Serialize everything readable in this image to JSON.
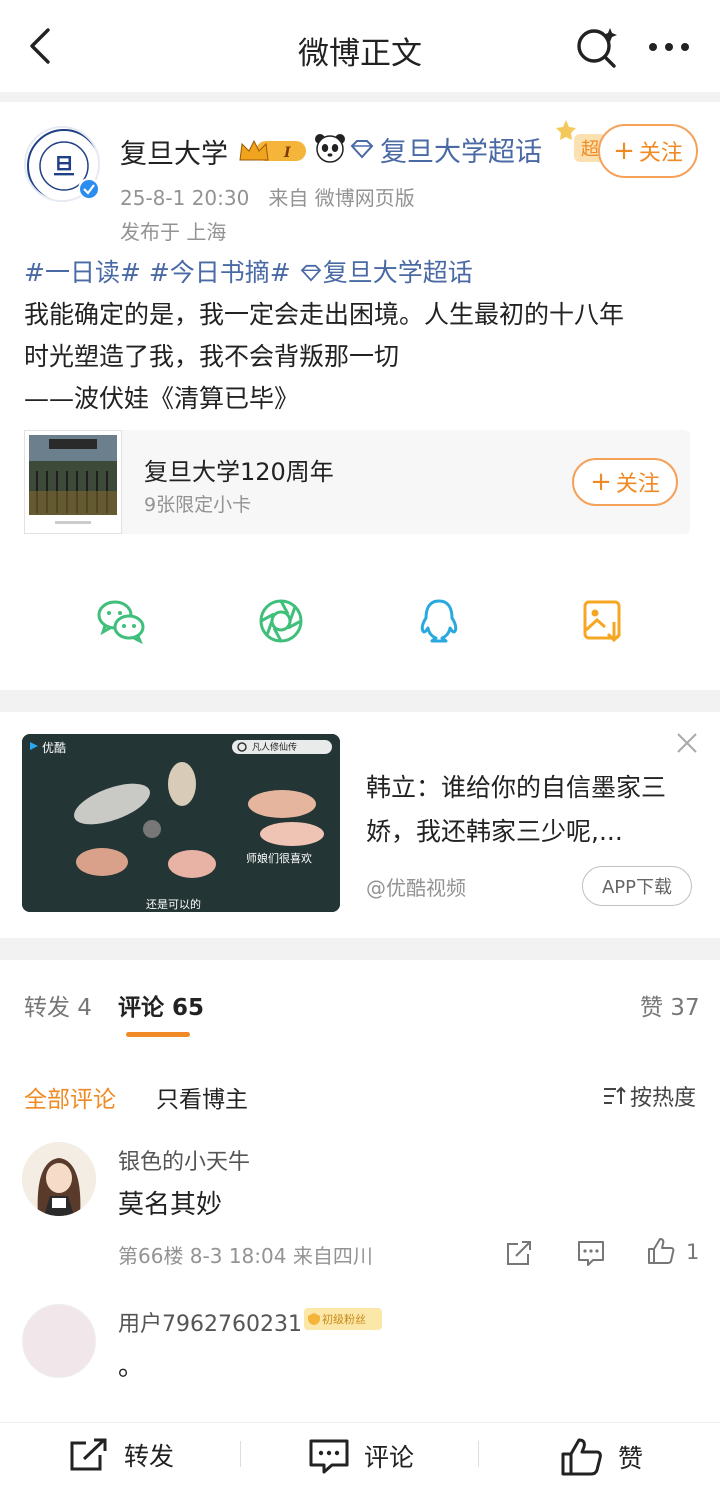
{
  "nav": {
    "title": "微博正文",
    "back_icon": "back-arrow-icon",
    "search_icon": "search-icon",
    "more_icon": "more-dots-icon"
  },
  "post": {
    "author": {
      "name": "复旦大学",
      "avatar_text": "FUDAN UNIVERSITY 1905",
      "crown_badge": "I",
      "supertopic": "复旦大学超话",
      "super_badge": "超"
    },
    "follow_label": "关注",
    "time": "25-8-1 20:30",
    "source": "来自 微博网页版",
    "location": "发布于 上海",
    "hashtags": [
      "#一日读#",
      "#今日书摘#"
    ],
    "topic_link": "复旦大学超话",
    "text_lines": [
      "我能确定的是，我一定会走出困境。人生最初的十八年",
      "时光塑造了我，我不会背叛那一切",
      "——波伏娃《清算已毕》"
    ],
    "card": {
      "title": "复旦大学120周年",
      "subtitle": "9张限定小卡",
      "follow_label": "关注"
    },
    "share_icons": [
      "wechat-icon",
      "moments-icon",
      "qq-icon",
      "save-image-icon"
    ]
  },
  "ad": {
    "title": "韩立：谁给你的自信墨家三娇，我还韩家三少呢,...",
    "source": "@优酷视频",
    "button": "APP下载",
    "video_logo": "优酷",
    "video_search": "凡人修仙传",
    "video_overlay_1": "师娘们很喜欢",
    "video_overlay_2": "还是可以的"
  },
  "tabs": {
    "repost_label": "转发 4",
    "comment_label": "评论 65",
    "like_label": "赞 37"
  },
  "comments": {
    "filter_all": "全部评论",
    "filter_author": "只看博主",
    "sort_label": "按热度",
    "items": [
      {
        "user": "银色的小天牛",
        "text": "莫名其妙",
        "meta": "第66楼  8-3 18:04  来自四川",
        "likes": "1"
      },
      {
        "user": "用户7962760231",
        "fan_badge": "初级粉丝",
        "text": "。"
      }
    ]
  },
  "bottombar": {
    "repost": "转发",
    "comment": "评论",
    "like": "赞"
  },
  "colors": {
    "accent": "#f08a24",
    "link": "#4a6aa5",
    "meta": "#939393"
  }
}
